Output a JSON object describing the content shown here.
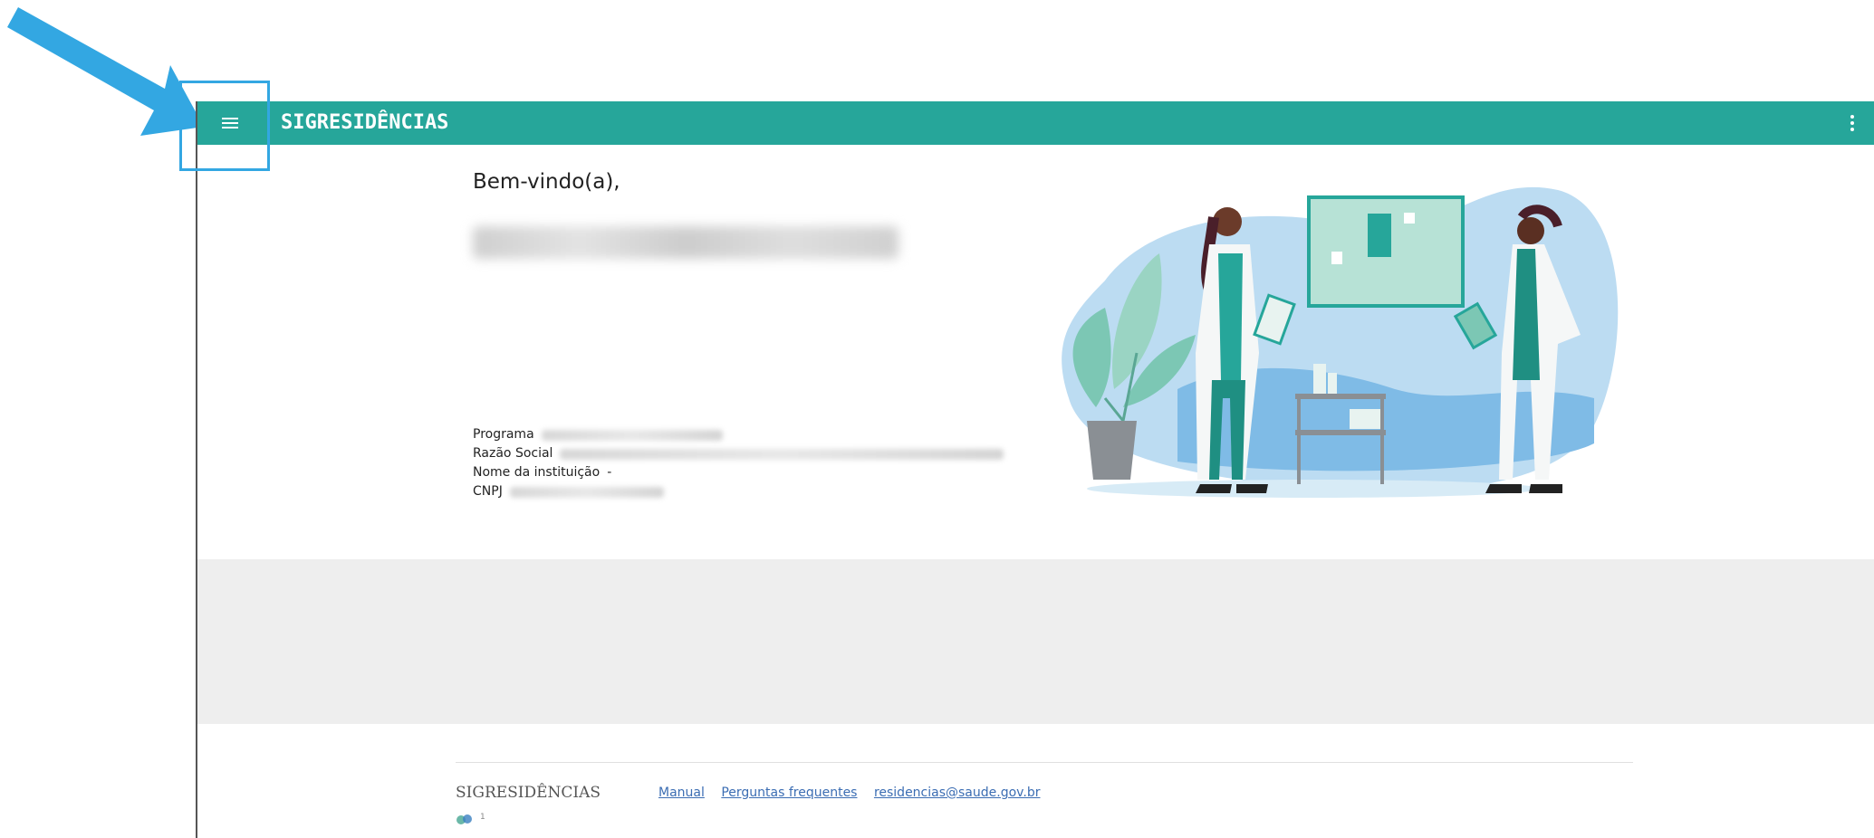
{
  "app": {
    "title": "SIGRESIDÊNCIAS",
    "accent_color": "#26a69a",
    "menu_icon": "hamburger-menu-icon",
    "more_icon": "more-vertical-icon"
  },
  "annotation": {
    "arrow_color": "#33a7e2",
    "highlight_target": "hamburger-menu-icon"
  },
  "welcome": {
    "greeting": "Bem-vindo(a),"
  },
  "info": {
    "programa_label": "Programa",
    "razao_social_label": "Razão Social",
    "nome_instituicao_label": "Nome da instituição",
    "nome_instituicao_value": "-",
    "cnpj_label": "CNPJ"
  },
  "footer": {
    "brand": "SIGRESIDÊNCIAS",
    "links": {
      "manual": "Manual",
      "faq": "Perguntas frequentes",
      "email": "residencias@saude.gov.br"
    },
    "version": "1"
  }
}
